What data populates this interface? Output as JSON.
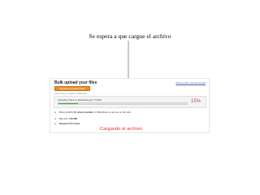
{
  "slide": {
    "caption_top": "Se espera a que cargue el archivo",
    "status_label": "Cargando el  archivo"
  },
  "screenshot": {
    "title": "Bulk upload your files",
    "top_link": "Show public uploads ahead",
    "browse_button": "Browse and select files",
    "hint": "hold Ctrl key to select multiple files",
    "uploading_text": "Uploading 'Save vs slideshare.ppt' (7.9 Mb)",
    "progress": 15,
    "progress_label": "15%",
    "rows": [
      {
        "prefix": "Share publicly",
        "bold": "Or share privately",
        "suffix": "on SlideShare or anyone on the web"
      },
      {
        "prefix": "Max size: ",
        "bold": "100 MB",
        "suffix": ""
      },
      {
        "prefix": "",
        "bold": "Supported Formats",
        "suffix": ""
      }
    ]
  },
  "colors": {
    "accent_orange": "#e8902e",
    "progress_green": "#3db34a",
    "annotation_red": "#e0332d",
    "arrow_gray": "#7a7a7a"
  }
}
